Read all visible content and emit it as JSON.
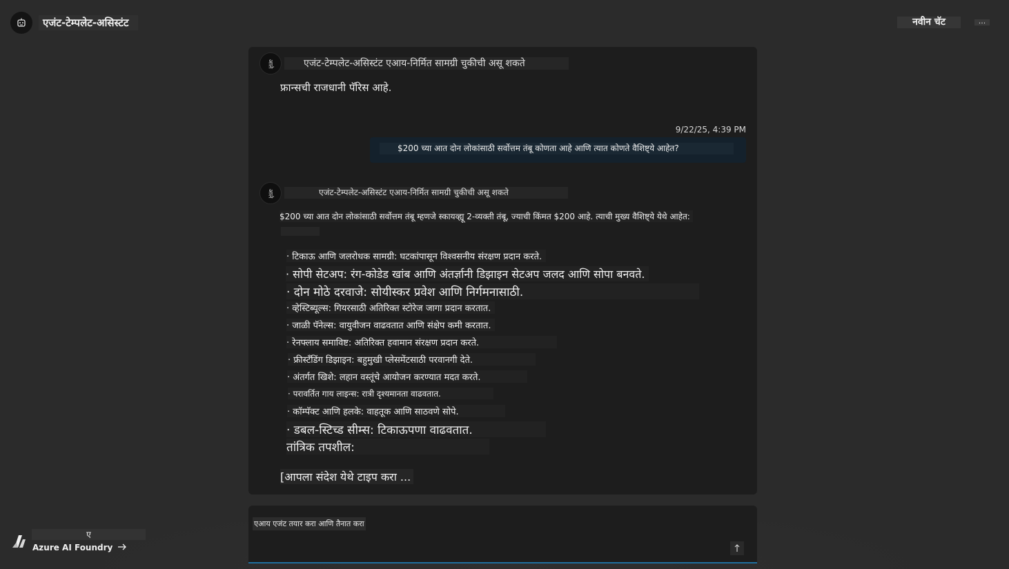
{
  "header": {
    "agent_name": "एजंट-टेम्पलेट-असिस्टंट",
    "new_chat_label": "नवीन चॅट",
    "more_label": "..."
  },
  "chat": {
    "bot_avatar_label": "आले",
    "message1": {
      "disclaimer": "एजंट-टेम्पलेट-असिस्टंट एआय-निर्मित सामग्री चुकीची असू शकते",
      "text": "फ्रान्सची राजधानी पॅरिस आहे."
    },
    "user_message": {
      "timestamp": "9/22/25, 4:39 PM",
      "text": "$200 च्या आत दोन लोकांसाठी सर्वोत्तम तंबू कोणता आहे आणि त्यात कोणते वैशिष्ट्ये आहेत?"
    },
    "message2": {
      "disclaimer": "एजंट-टेम्पलेट-असिस्टंट एआय-निर्मित सामग्री चुकीची असू शकते",
      "intro": "$200 च्या आत दोन लोकांसाठी सर्वोत्तम तंबू म्हणजे स्कायव्ह्यू 2-व्यक्ती तंबू, ज्याची किंमत $200 आहे. त्याची मुख्य वैशिष्ट्ये येथे आहेत:",
      "features": [
        "· टिकाऊ आणि जलरोधक सामग्री: घटकांपासून विश्वसनीय संरक्षण प्रदान करते.",
        "· सोपी सेटअप: रंग-कोडेड खांब आणि अंतर्ज्ञानी डिझाइन सेटअप जलद आणि सोपा बनवते.",
        "· दोन मोठे दरवाजे: सोयीस्कर प्रवेश आणि निर्गमनासाठी.",
        "· व्हेस्टिब्यूल्स: गियरसाठी अतिरिक्त स्टोरेज जागा प्रदान करतात.",
        "· जाळी पॅनेल्स: वायुवीजन वाढवतात आणि संक्षेप कमी करतात.",
        "· रेनफ्लाय समाविष्ट: अतिरिक्त हवामान संरक्षण प्रदान करते.",
        "· फ्रीस्टँडिंग डिझाइन: बहुमुखी प्लेसमेंटसाठी परवानगी देते.",
        "· अंतर्गत खिशे: लहान वस्तूंचे आयोजन करण्यात मदत करते.",
        "· परावर्तित गाय लाइन्स: रात्री दृश्यमानता वाढवतात.",
        "· कॉम्पॅक्ट आणि हलके: वाहतूक आणि साठवणे सोपे.",
        "· डबल-स्टिच्ड सीम्स: टिकाऊपणा वाढवतात."
      ],
      "tech_heading": "तांत्रिक तपशील:"
    },
    "typing_placeholder": "[आपला संदेश येथे टाइप करा ..."
  },
  "composer": {
    "placeholder": "एआय एजंट तयार करा आणि तैनात करा"
  },
  "footer": {
    "brand_top": "ए",
    "brand_link": "Azure AI Foundry"
  }
}
